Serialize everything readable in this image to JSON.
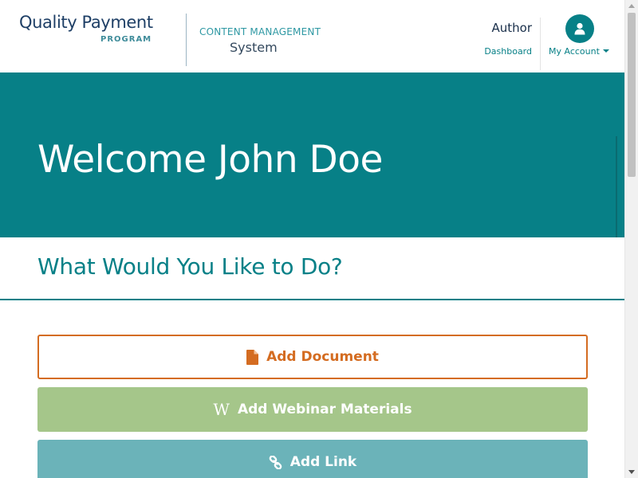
{
  "header": {
    "brand": {
      "main": "Quality Payment",
      "sub": "PROGRAM"
    },
    "app_name": {
      "line1": "CONTENT MANAGEMENT",
      "line2": "System"
    },
    "role": "Author",
    "dashboard_link": "Dashboard",
    "account_label": "My Account",
    "account_icon": "user-icon"
  },
  "hero": {
    "title": "Welcome John Doe"
  },
  "section": {
    "title": "What Would You Like to Do?"
  },
  "actions": [
    {
      "label": "Add Document",
      "icon": "document-icon"
    },
    {
      "label": "Add Webinar Materials",
      "icon": "wikipedia-w-icon"
    },
    {
      "label": "Add Link",
      "icon": "link-icon"
    }
  ],
  "colors": {
    "brand_teal": "#078087",
    "document_orange": "#d46c21",
    "webinar_green": "#a5c68a",
    "link_teal": "#6bb3b9"
  }
}
